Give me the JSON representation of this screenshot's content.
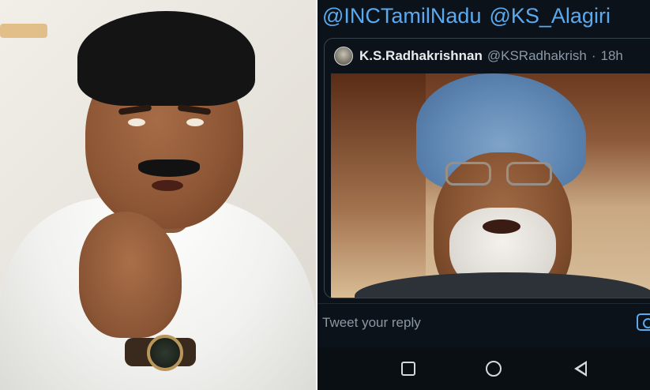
{
  "tweet": {
    "mentions": [
      "@INCTamilNadu",
      "@KS_Alagiri"
    ],
    "quoted": {
      "author": "K.S.Radhakrishnan",
      "handle": "@KSRadhakrish",
      "separator": "·",
      "time": "18h"
    }
  },
  "reply": {
    "placeholder": "Tweet your reply",
    "camera_icon": "camera-icon"
  },
  "navigation": {
    "recent_icon": "recent-apps-icon",
    "home_icon": "home-icon",
    "back_icon": "back-icon"
  },
  "colors": {
    "accent": "#5aaaf0",
    "background": "#0c1219",
    "muted_text": "#8b98a5"
  }
}
